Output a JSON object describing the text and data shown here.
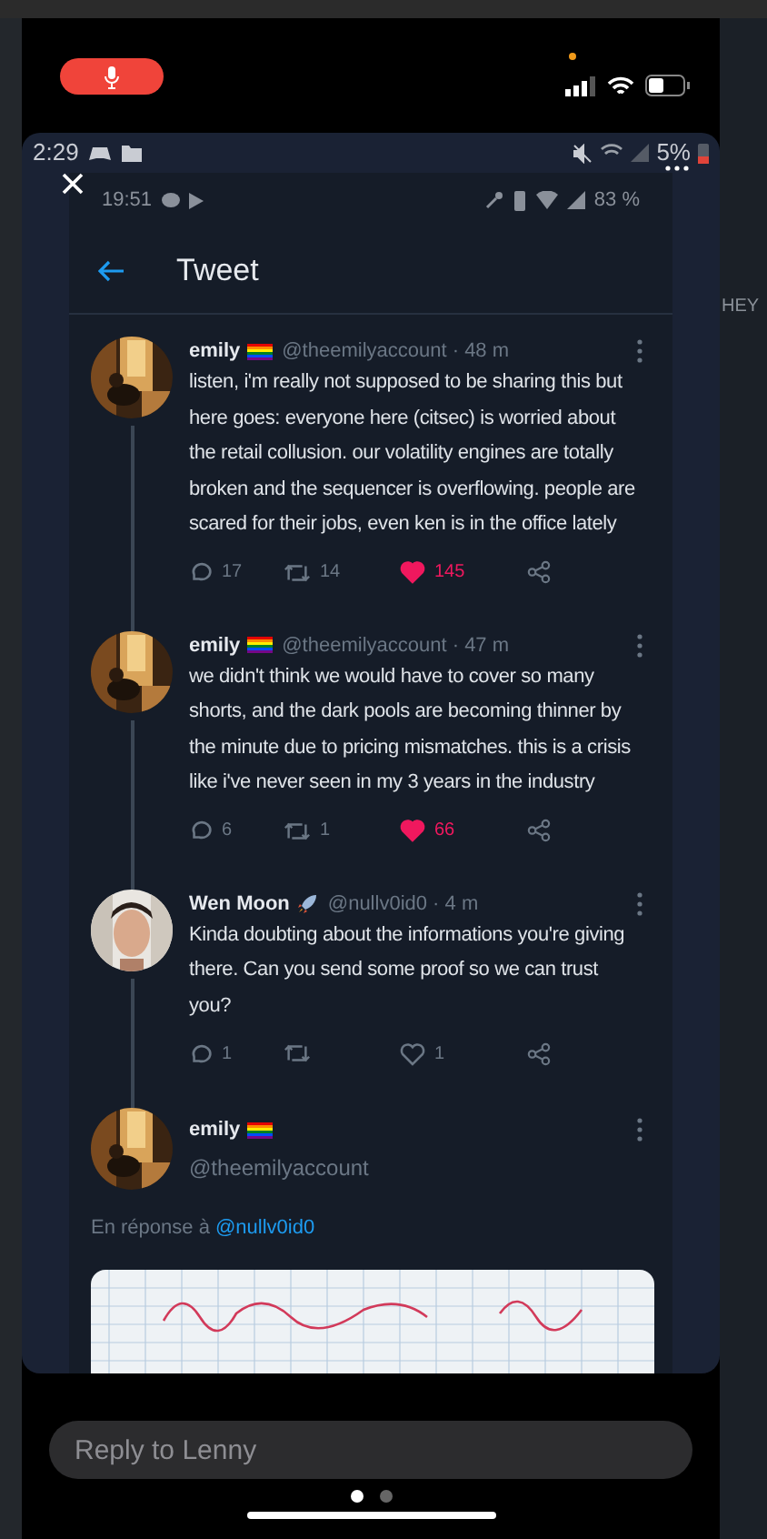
{
  "side_text": "HEY",
  "phone_status": {
    "time": "2:29",
    "battery": "5%"
  },
  "inner_status": {
    "time": "19:51",
    "battery": "83 %"
  },
  "header": {
    "title": "Tweet"
  },
  "tweets": [
    {
      "name": "emily",
      "kind": "flag",
      "meta": "@theemilyaccount · 48 m",
      "text": "listen, i'm really not supposed to be sharing this but here goes: everyone here (citsec) is worried about the retail collusion. our volatility engines are totally broken and the sequencer is overflowing. people are scared for their jobs, even ken is in the office lately",
      "replies": "17",
      "retweets": "14",
      "likes": "145",
      "liked": true
    },
    {
      "name": "emily",
      "kind": "flag",
      "meta": "@theemilyaccount · 47 m",
      "text": "we didn't think we would have to cover so many shorts, and the dark pools are becoming thinner by the minute due to pricing mismatches. this is a crisis like i've never seen in my 3 years in the industry",
      "replies": "6",
      "retweets": "1",
      "likes": "66",
      "liked": true
    },
    {
      "name": "Wen Moon",
      "kind": "rocket",
      "meta": "@nullv0id0 · 4 m",
      "text": "Kinda doubting about the informations you're giving there. Can you send some proof so we can trust you?",
      "replies": "1",
      "likes": "1",
      "liked": false
    }
  ],
  "main_tweet": {
    "name": "emily",
    "kind": "flag",
    "handle": "@theemilyaccount",
    "reply_prefix": "En réponse à",
    "reply_mention": "@nullv0id0"
  },
  "reply_field": {
    "placeholder": "Reply to Lenny"
  },
  "page_dots": [
    {
      "selected": true
    },
    {
      "selected": false
    }
  ]
}
